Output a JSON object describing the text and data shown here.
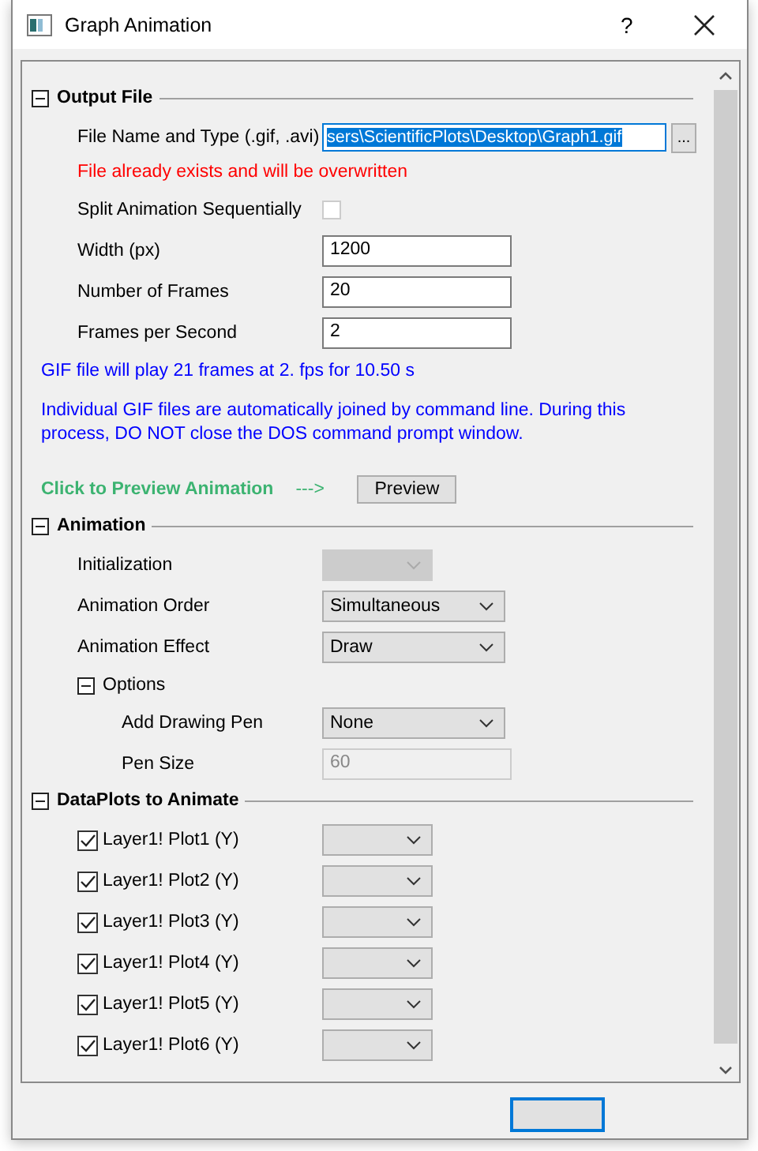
{
  "window": {
    "title": "Graph Animation",
    "help": "?"
  },
  "sections": [
    {
      "title": "Output File",
      "expanded": true,
      "rows": [
        {
          "kind": "file",
          "label": "File Name and Type (.gif, .avi)",
          "value": "sers\\ScientificPlots\\Desktop\\Graph1.gif",
          "browse": "..."
        },
        {
          "kind": "message",
          "text": "File already exists and will be overwritten",
          "color": "#ff0000"
        },
        {
          "kind": "checkbox",
          "label": "Split Animation Sequentially",
          "checked": false
        },
        {
          "kind": "text",
          "label": "Width (px)",
          "value": "1200",
          "disabled": false
        },
        {
          "kind": "text",
          "label": "Number of Frames",
          "value": "20",
          "disabled": false
        },
        {
          "kind": "text",
          "label": "Frames per Second",
          "value": "2",
          "disabled": false
        },
        {
          "kind": "info",
          "text": "GIF file will play 21 frames at 2. fps for 10.50 s",
          "color": "#0000ff"
        },
        {
          "kind": "info",
          "text": "Individual GIF files are automatically joined by command line. During this process, DO NOT close the DOS command prompt window.",
          "color": "#0000ff"
        },
        {
          "kind": "preview",
          "text": "Click to Preview Animation",
          "arrow": "--->",
          "button": "Preview",
          "color": "#3cb371"
        }
      ]
    },
    {
      "title": "Animation",
      "expanded": true,
      "rows": [
        {
          "kind": "dropdown",
          "label": "Initialization",
          "disabled": true
        },
        {
          "kind": "dropdown",
          "label": "Animation Order",
          "value": "Simultaneous",
          "disabled": false
        },
        {
          "kind": "dropdown",
          "label": "Animation Effect",
          "value": "Draw",
          "disabled": false
        },
        {
          "kind": "group",
          "label": "Options",
          "expanded": true,
          "children": [
            {
              "kind": "dropdown",
              "label": "Add Drawing Pen",
              "value": "None",
              "disabled": false
            },
            {
              "kind": "text",
              "label": "Pen Size",
              "value": "60",
              "disabled": true
            }
          ]
        }
      ]
    },
    {
      "title": "DataPlots to Animate",
      "expanded": true,
      "rows": [
        {
          "kind": "plot",
          "label": "Layer1! Plot1 (Y)",
          "checked": true
        },
        {
          "kind": "plot",
          "label": "Layer1! Plot2 (Y)",
          "checked": true
        },
        {
          "kind": "plot",
          "label": "Layer1! Plot3 (Y)",
          "checked": true
        },
        {
          "kind": "plot",
          "label": "Layer1! Plot4 (Y)",
          "checked": true
        },
        {
          "kind": "plot",
          "label": "Layer1! Plot5 (Y)",
          "checked": true
        },
        {
          "kind": "plot",
          "label": "Layer1! Plot6 (Y)",
          "checked": true
        }
      ]
    }
  ]
}
